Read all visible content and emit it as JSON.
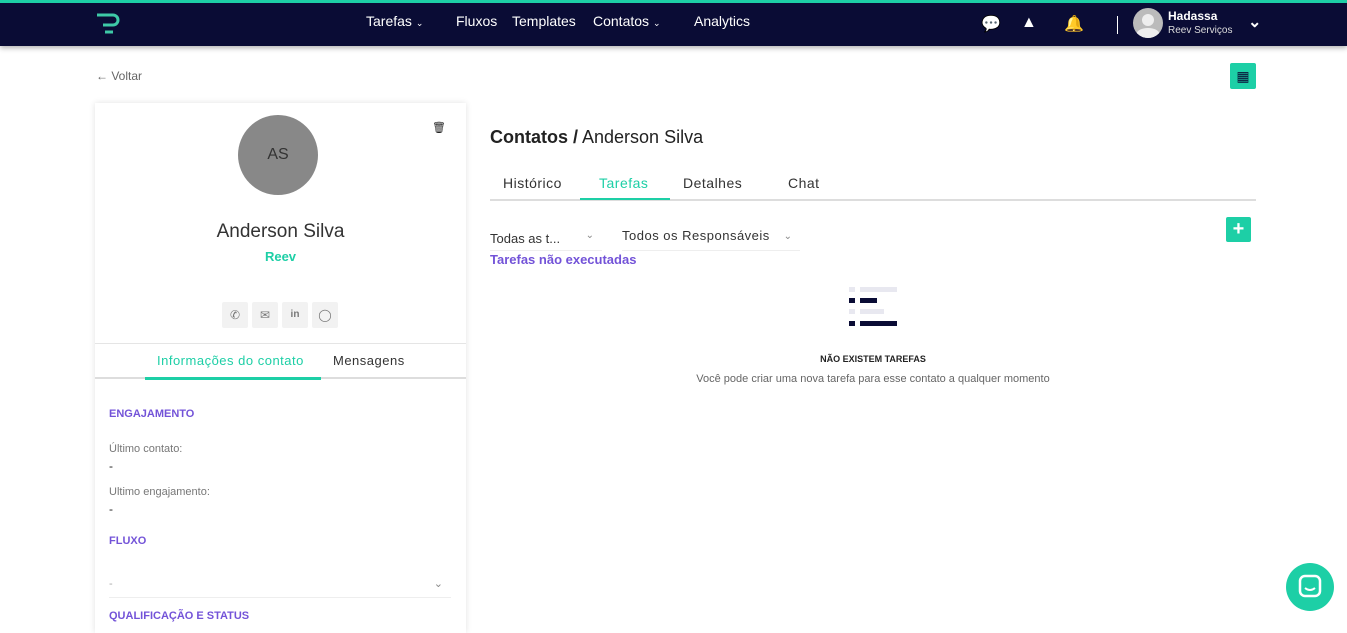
{
  "nav": {
    "items": [
      "Tarefas",
      "Fluxos",
      "Templates",
      "Contatos",
      "Analytics"
    ],
    "user": {
      "name": "Hadassa",
      "company": "Reev Serviços"
    }
  },
  "back": "Voltar",
  "contact": {
    "initials": "AS",
    "name": "Anderson Silva",
    "company": "Reev",
    "tabs": [
      "Informações do contato",
      "Mensagens"
    ],
    "sections": {
      "engagement": "ENGAJAMENTO",
      "last_contact_label": "Último contato:",
      "last_contact": "-",
      "last_engagement_label": "Ultimo engajamento:",
      "last_engagement": "-",
      "flow": "FLUXO",
      "flow_value": "-",
      "qualification": "QUALIFICAÇÃO E STATUS"
    }
  },
  "main": {
    "title_prefix": "Contatos /",
    "title_name": "Anderson Silva",
    "tabs": [
      "Histórico",
      "Tarefas",
      "Detalhes",
      "Chat"
    ],
    "filter_tasks": "Todas as t...",
    "filter_owner": "Todos os Responsáveis",
    "link": "Tarefas não executadas",
    "empty_title": "NÃO EXISTEM TAREFAS",
    "empty_sub": "Você pode criar uma nova tarefa para esse contato a qualquer momento"
  },
  "colors": {
    "accent": "#1dcfa6",
    "nav": "#0a0c35",
    "purple": "#7353d8"
  }
}
